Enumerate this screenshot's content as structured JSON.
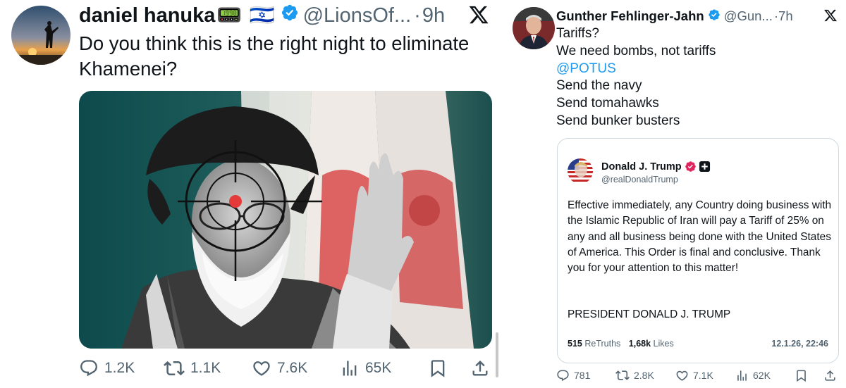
{
  "left_tweet": {
    "author_name": "daniel hanuka",
    "name_emoji": "📟",
    "flag": "🇮🇱",
    "handle": "@LionsOf...",
    "separator": "·",
    "time": "9h",
    "text": "Do you think this is the right night to eliminate Khamenei?",
    "actions": {
      "replies": "1.2K",
      "reposts": "1.1K",
      "likes": "7.6K",
      "views": "65K"
    }
  },
  "right_tweet": {
    "author_name": "Gunther Fehlinger-Jahn",
    "handle": "@Gun...",
    "separator": "·",
    "time": "7h",
    "lines": [
      "Tariffs?",
      "We need bombs, not tariffs",
      "@POTUS",
      "Send the navy",
      "Send tomahawks",
      "Send bunker busters"
    ],
    "quoted_post": {
      "author_name": "Donald J. Trump",
      "handle": "@realDonaldTrump",
      "body": "Effective immediately, any Country doing business with the Islamic Republic of Iran will pay a Tariff of 25% on any and all business being done with the United States of America. This Order is final and conclusive. Thank you for your attention to this matter!",
      "signature": "PRESIDENT DONALD J. TRUMP",
      "retruths_count": "515",
      "retruths_label": "ReTruths",
      "likes_count": "1,68k",
      "likes_label": "Likes",
      "date": "12.1.26, 22:46"
    },
    "actions": {
      "replies": "781",
      "reposts": "2.8K",
      "likes": "7.1K",
      "views": "62K"
    }
  },
  "colors": {
    "verified_blue": "#1d9bf0",
    "truth_badge": "#e0245e",
    "text_primary": "#0f1419",
    "text_secondary": "#536471",
    "mention": "#1d9bf0",
    "border": "#cfd9de"
  },
  "icons": [
    "x-logo-icon",
    "verified-badge-icon",
    "reply-icon",
    "repost-icon",
    "like-icon",
    "views-icon",
    "bookmark-icon",
    "share-icon",
    "plus-badge-icon"
  ]
}
